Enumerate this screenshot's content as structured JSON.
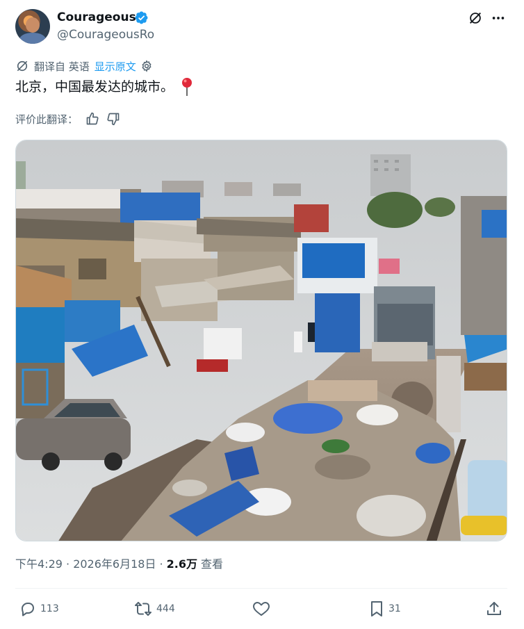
{
  "author": {
    "name": "Courageous",
    "handle": "@CourageousRo",
    "avatar_icon": "avatar-icon",
    "verified_color": "#1d9bf0"
  },
  "translation": {
    "label": "翻译自 英语",
    "show_original": "显示原文",
    "rate_label": "评价此翻译："
  },
  "tweet": {
    "text": "北京，中国最发达的城市。",
    "pin_icon": "location-pin-icon"
  },
  "meta": {
    "time": "下午4:29 · 2026年6月18日 · ",
    "views_count": "2.6万",
    "views_label": "查看"
  },
  "actions": {
    "replies": "113",
    "retweets": "444",
    "bookmarks": "31"
  },
  "colors": {
    "accent": "#1d9bf0",
    "secondary_text": "#536471",
    "primary_text": "#0f1419"
  }
}
